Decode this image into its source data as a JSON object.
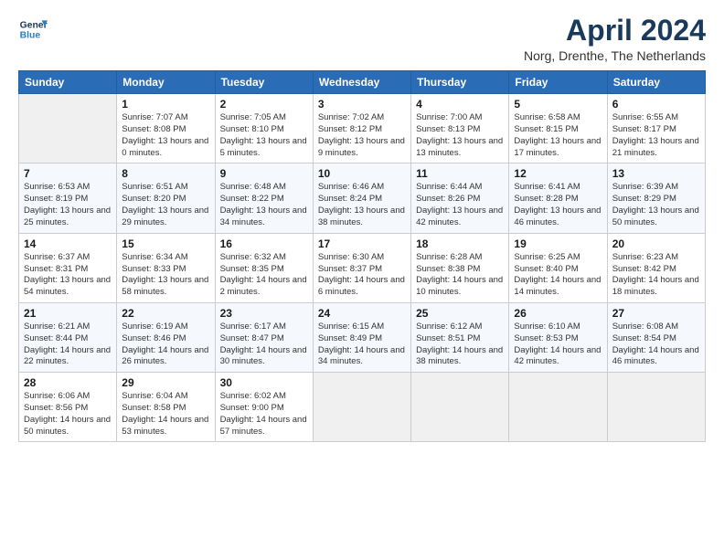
{
  "header": {
    "logo_line1": "General",
    "logo_line2": "Blue",
    "month": "April 2024",
    "location": "Norg, Drenthe, The Netherlands"
  },
  "weekdays": [
    "Sunday",
    "Monday",
    "Tuesday",
    "Wednesday",
    "Thursday",
    "Friday",
    "Saturday"
  ],
  "weeks": [
    [
      {
        "num": "",
        "sunrise": "",
        "sunset": "",
        "daylight": ""
      },
      {
        "num": "1",
        "sunrise": "Sunrise: 7:07 AM",
        "sunset": "Sunset: 8:08 PM",
        "daylight": "Daylight: 13 hours and 0 minutes."
      },
      {
        "num": "2",
        "sunrise": "Sunrise: 7:05 AM",
        "sunset": "Sunset: 8:10 PM",
        "daylight": "Daylight: 13 hours and 5 minutes."
      },
      {
        "num": "3",
        "sunrise": "Sunrise: 7:02 AM",
        "sunset": "Sunset: 8:12 PM",
        "daylight": "Daylight: 13 hours and 9 minutes."
      },
      {
        "num": "4",
        "sunrise": "Sunrise: 7:00 AM",
        "sunset": "Sunset: 8:13 PM",
        "daylight": "Daylight: 13 hours and 13 minutes."
      },
      {
        "num": "5",
        "sunrise": "Sunrise: 6:58 AM",
        "sunset": "Sunset: 8:15 PM",
        "daylight": "Daylight: 13 hours and 17 minutes."
      },
      {
        "num": "6",
        "sunrise": "Sunrise: 6:55 AM",
        "sunset": "Sunset: 8:17 PM",
        "daylight": "Daylight: 13 hours and 21 minutes."
      }
    ],
    [
      {
        "num": "7",
        "sunrise": "Sunrise: 6:53 AM",
        "sunset": "Sunset: 8:19 PM",
        "daylight": "Daylight: 13 hours and 25 minutes."
      },
      {
        "num": "8",
        "sunrise": "Sunrise: 6:51 AM",
        "sunset": "Sunset: 8:20 PM",
        "daylight": "Daylight: 13 hours and 29 minutes."
      },
      {
        "num": "9",
        "sunrise": "Sunrise: 6:48 AM",
        "sunset": "Sunset: 8:22 PM",
        "daylight": "Daylight: 13 hours and 34 minutes."
      },
      {
        "num": "10",
        "sunrise": "Sunrise: 6:46 AM",
        "sunset": "Sunset: 8:24 PM",
        "daylight": "Daylight: 13 hours and 38 minutes."
      },
      {
        "num": "11",
        "sunrise": "Sunrise: 6:44 AM",
        "sunset": "Sunset: 8:26 PM",
        "daylight": "Daylight: 13 hours and 42 minutes."
      },
      {
        "num": "12",
        "sunrise": "Sunrise: 6:41 AM",
        "sunset": "Sunset: 8:28 PM",
        "daylight": "Daylight: 13 hours and 46 minutes."
      },
      {
        "num": "13",
        "sunrise": "Sunrise: 6:39 AM",
        "sunset": "Sunset: 8:29 PM",
        "daylight": "Daylight: 13 hours and 50 minutes."
      }
    ],
    [
      {
        "num": "14",
        "sunrise": "Sunrise: 6:37 AM",
        "sunset": "Sunset: 8:31 PM",
        "daylight": "Daylight: 13 hours and 54 minutes."
      },
      {
        "num": "15",
        "sunrise": "Sunrise: 6:34 AM",
        "sunset": "Sunset: 8:33 PM",
        "daylight": "Daylight: 13 hours and 58 minutes."
      },
      {
        "num": "16",
        "sunrise": "Sunrise: 6:32 AM",
        "sunset": "Sunset: 8:35 PM",
        "daylight": "Daylight: 14 hours and 2 minutes."
      },
      {
        "num": "17",
        "sunrise": "Sunrise: 6:30 AM",
        "sunset": "Sunset: 8:37 PM",
        "daylight": "Daylight: 14 hours and 6 minutes."
      },
      {
        "num": "18",
        "sunrise": "Sunrise: 6:28 AM",
        "sunset": "Sunset: 8:38 PM",
        "daylight": "Daylight: 14 hours and 10 minutes."
      },
      {
        "num": "19",
        "sunrise": "Sunrise: 6:25 AM",
        "sunset": "Sunset: 8:40 PM",
        "daylight": "Daylight: 14 hours and 14 minutes."
      },
      {
        "num": "20",
        "sunrise": "Sunrise: 6:23 AM",
        "sunset": "Sunset: 8:42 PM",
        "daylight": "Daylight: 14 hours and 18 minutes."
      }
    ],
    [
      {
        "num": "21",
        "sunrise": "Sunrise: 6:21 AM",
        "sunset": "Sunset: 8:44 PM",
        "daylight": "Daylight: 14 hours and 22 minutes."
      },
      {
        "num": "22",
        "sunrise": "Sunrise: 6:19 AM",
        "sunset": "Sunset: 8:46 PM",
        "daylight": "Daylight: 14 hours and 26 minutes."
      },
      {
        "num": "23",
        "sunrise": "Sunrise: 6:17 AM",
        "sunset": "Sunset: 8:47 PM",
        "daylight": "Daylight: 14 hours and 30 minutes."
      },
      {
        "num": "24",
        "sunrise": "Sunrise: 6:15 AM",
        "sunset": "Sunset: 8:49 PM",
        "daylight": "Daylight: 14 hours and 34 minutes."
      },
      {
        "num": "25",
        "sunrise": "Sunrise: 6:12 AM",
        "sunset": "Sunset: 8:51 PM",
        "daylight": "Daylight: 14 hours and 38 minutes."
      },
      {
        "num": "26",
        "sunrise": "Sunrise: 6:10 AM",
        "sunset": "Sunset: 8:53 PM",
        "daylight": "Daylight: 14 hours and 42 minutes."
      },
      {
        "num": "27",
        "sunrise": "Sunrise: 6:08 AM",
        "sunset": "Sunset: 8:54 PM",
        "daylight": "Daylight: 14 hours and 46 minutes."
      }
    ],
    [
      {
        "num": "28",
        "sunrise": "Sunrise: 6:06 AM",
        "sunset": "Sunset: 8:56 PM",
        "daylight": "Daylight: 14 hours and 50 minutes."
      },
      {
        "num": "29",
        "sunrise": "Sunrise: 6:04 AM",
        "sunset": "Sunset: 8:58 PM",
        "daylight": "Daylight: 14 hours and 53 minutes."
      },
      {
        "num": "30",
        "sunrise": "Sunrise: 6:02 AM",
        "sunset": "Sunset: 9:00 PM",
        "daylight": "Daylight: 14 hours and 57 minutes."
      },
      {
        "num": "",
        "sunrise": "",
        "sunset": "",
        "daylight": ""
      },
      {
        "num": "",
        "sunrise": "",
        "sunset": "",
        "daylight": ""
      },
      {
        "num": "",
        "sunrise": "",
        "sunset": "",
        "daylight": ""
      },
      {
        "num": "",
        "sunrise": "",
        "sunset": "",
        "daylight": ""
      }
    ]
  ]
}
